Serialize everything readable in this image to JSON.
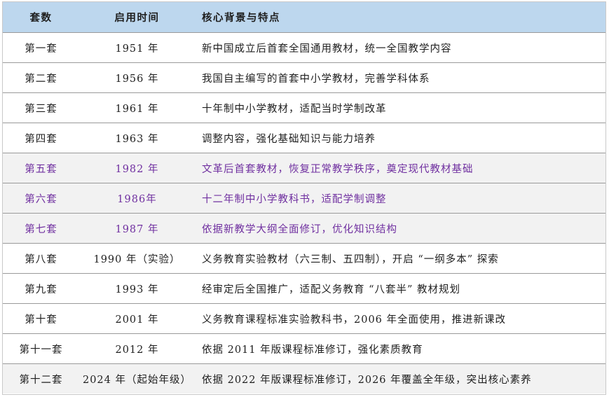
{
  "table": {
    "headers": [
      "套数",
      "启用时间",
      "核心背景与特点"
    ],
    "colors": {
      "header_bg": "#bdd7ee",
      "shaded_row_bg": "#f2f2f2",
      "highlight_text": "#7030a0"
    },
    "rows": [
      {
        "set": "第一套",
        "year": "1951 年",
        "desc": "新中国成立后首套全国通用教材，统一全国教学内容",
        "shaded": false,
        "highlight": false
      },
      {
        "set": "第二套",
        "year": "1956 年",
        "desc": "我国自主编写的首套中小学教材，完善学科体系",
        "shaded": false,
        "highlight": false
      },
      {
        "set": "第三套",
        "year": "1961 年",
        "desc": "十年制中小学教材，适配当时学制改革",
        "shaded": false,
        "highlight": false
      },
      {
        "set": "第四套",
        "year": "1963 年",
        "desc": "调整内容，强化基础知识与能力培养",
        "shaded": false,
        "highlight": false
      },
      {
        "set": "第五套",
        "year": "1982 年",
        "desc": "文革后首套教材，恢复正常教学秩序，奠定现代教材基础",
        "shaded": true,
        "highlight": true
      },
      {
        "set": "第六套",
        "year": "1986年",
        "desc": "十二年制中小学教科书，适配学制调整",
        "shaded": true,
        "highlight": true
      },
      {
        "set": "第七套",
        "year": "1987 年",
        "desc": "依据新教学大纲全面修订，优化知识结构",
        "shaded": true,
        "highlight": true
      },
      {
        "set": "第八套",
        "year": "1990 年（实验）",
        "desc": "义务教育实验教材（六三制、五四制），开启 “一纲多本” 探索",
        "shaded": false,
        "highlight": false
      },
      {
        "set": "第九套",
        "year": "1993 年",
        "desc": "经审定后全国推广，适配义务教育 “八套半” 教材规划",
        "shaded": false,
        "highlight": false
      },
      {
        "set": "第十套",
        "year": "2001 年",
        "desc": "义务教育课程标准实验教科书，2006 年全面使用，推进新课改",
        "shaded": false,
        "highlight": false
      },
      {
        "set": "第十一套",
        "year": "2012 年",
        "desc": "依据 2011 年版课程标准修订，强化素质教育",
        "shaded": false,
        "highlight": false
      },
      {
        "set": "第十二套",
        "year": "2024 年（起始年级）",
        "desc": "依据 2022 年版课程标准修订，2026 年覆盖全年级，突出核心素养",
        "shaded": true,
        "highlight": false
      }
    ]
  }
}
